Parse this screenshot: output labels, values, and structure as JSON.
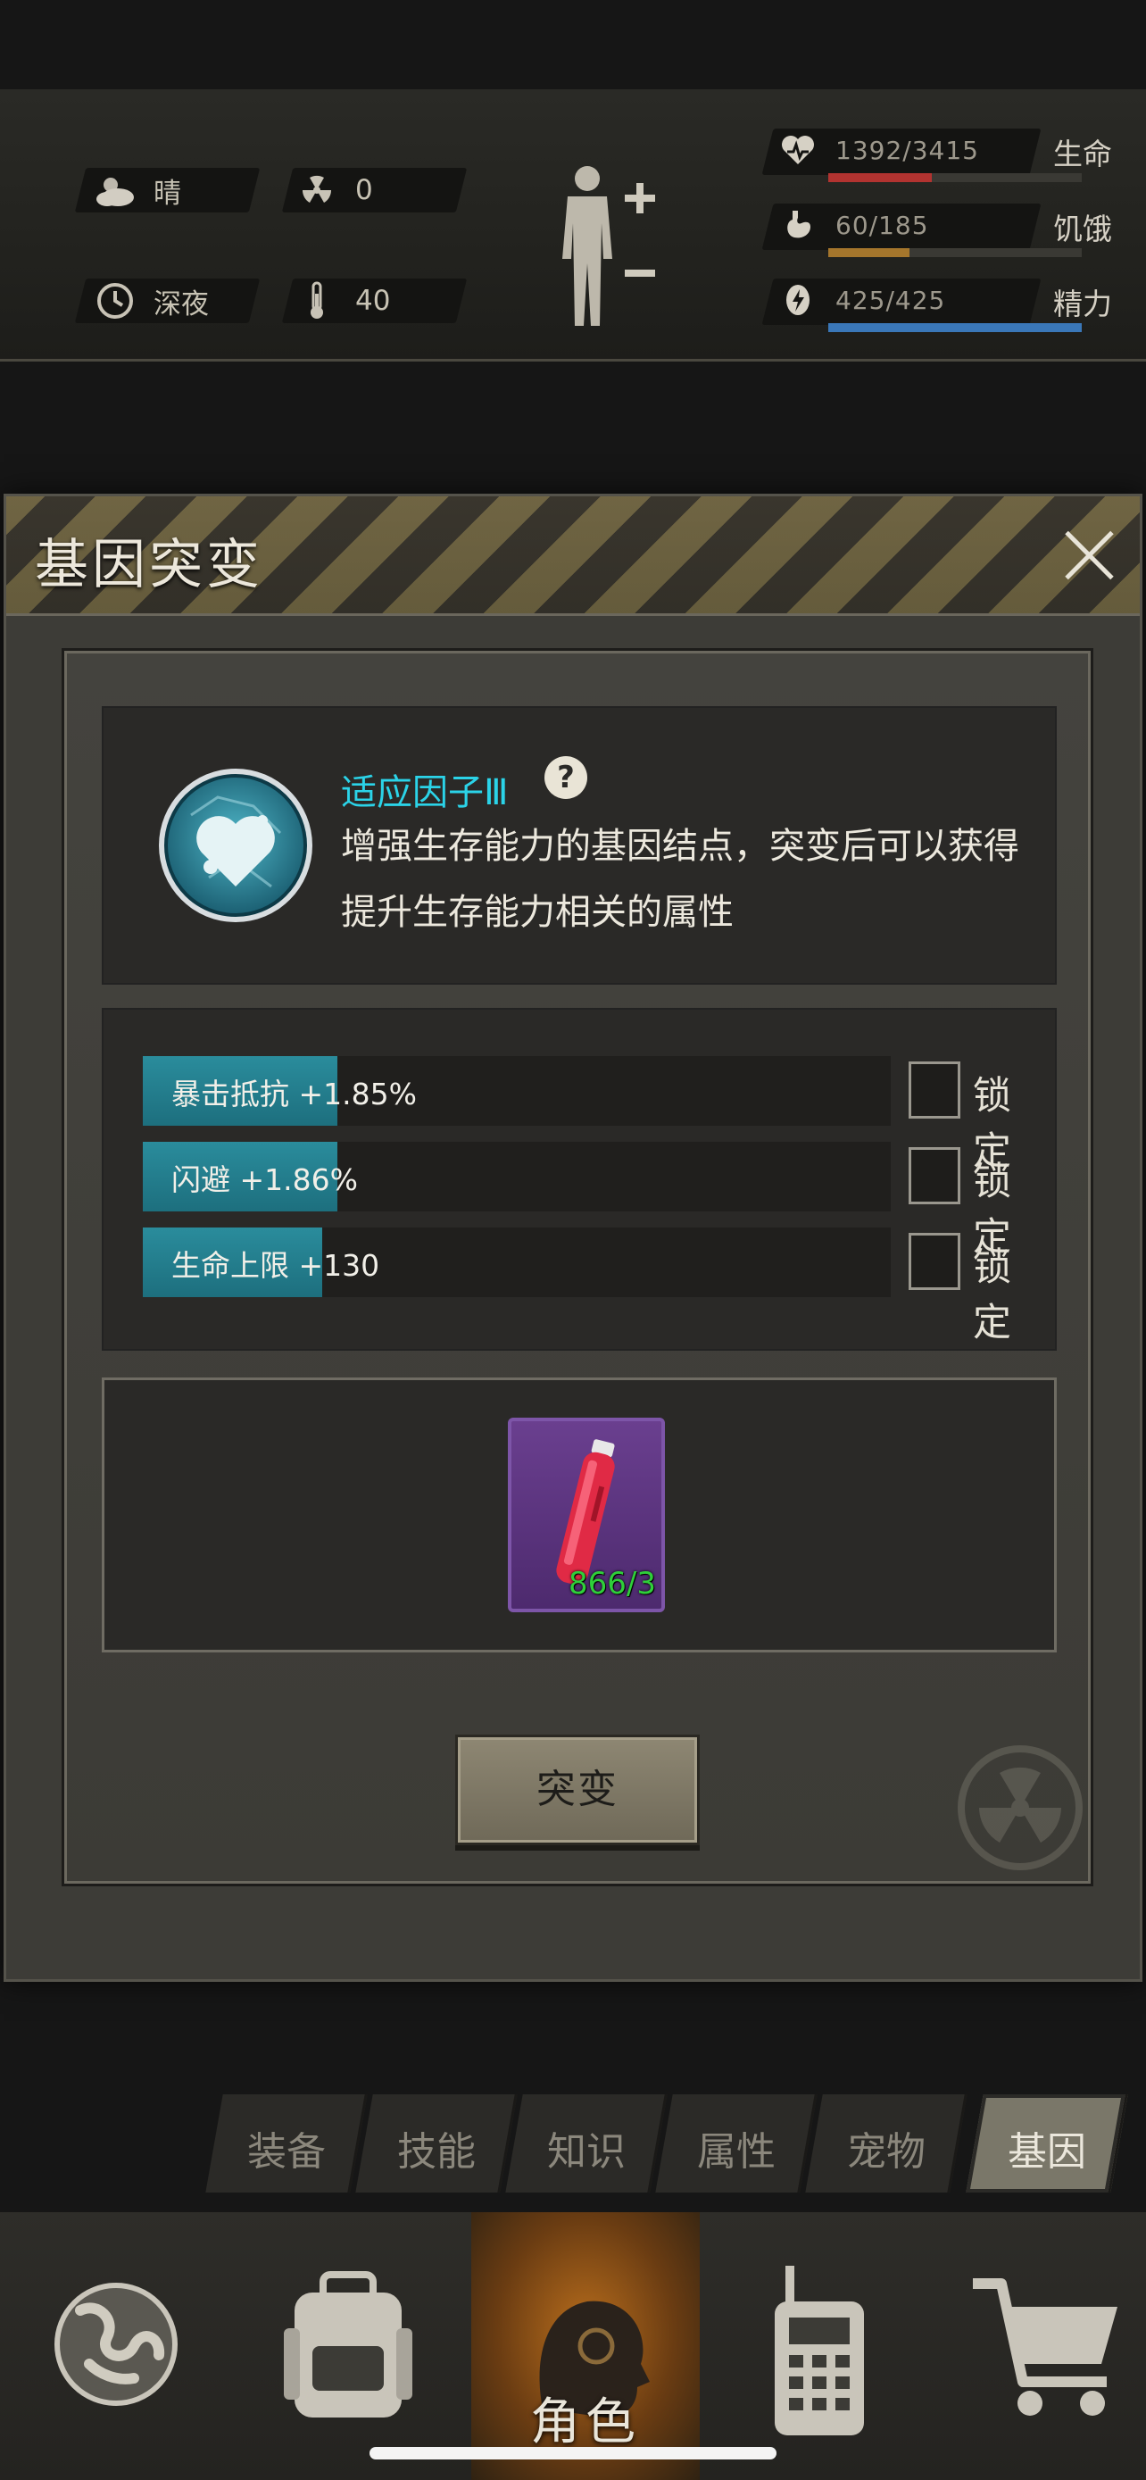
{
  "hud": {
    "weather": {
      "icon": "cloud-sun-icon",
      "label": "晴"
    },
    "radiation": {
      "icon": "radiation-icon",
      "value": "0"
    },
    "time": {
      "icon": "clock-icon",
      "label": "深夜"
    },
    "temperature": {
      "icon": "thermometer-icon",
      "value": "40"
    },
    "stats": [
      {
        "icon": "heart-icon",
        "value": "1392/3415",
        "label": "生命",
        "fill": 0.41,
        "color": "#b23330"
      },
      {
        "icon": "stomach-icon",
        "value": "60/185",
        "label": "饥饿",
        "fill": 0.32,
        "color": "#a5762c"
      },
      {
        "icon": "energy-icon",
        "value": "425/425",
        "label": "精力",
        "fill": 1.0,
        "color": "#3a77b8"
      }
    ]
  },
  "modal": {
    "title": "基因突变",
    "gene": {
      "name": "适应因子Ⅲ",
      "help": "?",
      "description": "增强生存能力的基因结点，突变后可以获得提升生存能力相关的属性"
    },
    "attributes": [
      {
        "text": "暴击抵抗 +1.85%",
        "fill": 0.26,
        "lock_label": "锁定"
      },
      {
        "text": "闪避 +1.86%",
        "fill": 0.26,
        "lock_label": "锁定"
      },
      {
        "text": "生命上限 +130",
        "fill": 0.24,
        "lock_label": "锁定"
      }
    ],
    "item": {
      "icon": "serum-vial-icon",
      "count": "866/3"
    },
    "mutate_button": "突变"
  },
  "tabs": [
    {
      "label": "装备",
      "active": false
    },
    {
      "label": "技能",
      "active": false
    },
    {
      "label": "知识",
      "active": false
    },
    {
      "label": "属性",
      "active": false
    },
    {
      "label": "宠物",
      "active": false
    },
    {
      "label": "基因",
      "active": true
    }
  ],
  "bottom_nav": [
    {
      "icon": "globe-icon",
      "label": "",
      "active": false
    },
    {
      "icon": "backpack-icon",
      "label": "",
      "active": false
    },
    {
      "icon": "character-head-icon",
      "label": "角色",
      "active": true
    },
    {
      "icon": "walkie-talkie-icon",
      "label": "",
      "active": false
    },
    {
      "icon": "shopping-cart-icon",
      "label": "",
      "active": false
    }
  ]
}
